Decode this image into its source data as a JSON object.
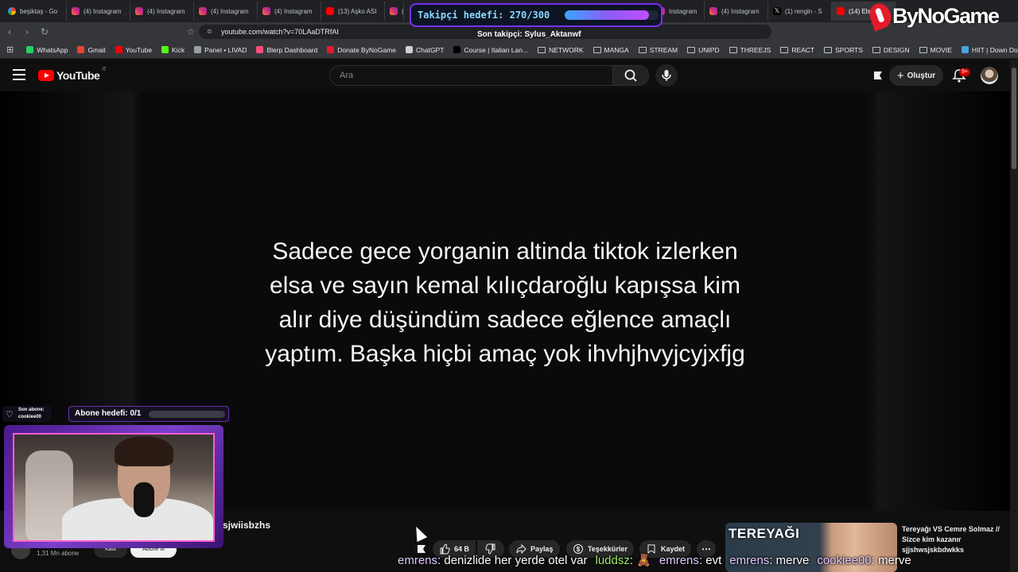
{
  "browser": {
    "tabs": [
      {
        "label": "beşiktaş - Go",
        "icon": "google-icon"
      },
      {
        "label": "(4) Instagram",
        "icon": "instagram-icon"
      },
      {
        "label": "(4) Instagram",
        "icon": "instagram-icon"
      },
      {
        "label": "(4) Instagram",
        "icon": "instagram-icon"
      },
      {
        "label": "(4) Instagram",
        "icon": "instagram-icon"
      },
      {
        "label": "(13) Aşko ASI",
        "icon": "youtube-icon"
      },
      {
        "label": "(4",
        "icon": "instagram-icon"
      },
      {
        "label": "Instagram",
        "icon": "instagram-icon"
      },
      {
        "label": "(4) Instagram",
        "icon": "instagram-icon"
      },
      {
        "label": "(1) rengin - S",
        "icon": "x-icon"
      },
      {
        "label": "(14) Els",
        "icon": "youtube-icon"
      }
    ],
    "url": "youtube.com/watch?v=70LAaDTRfAI",
    "bookmarks": [
      {
        "label": "WhatsApp",
        "type": "site",
        "color": "#25d366"
      },
      {
        "label": "Gmail",
        "type": "site",
        "color": "#ea4335"
      },
      {
        "label": "YouTube",
        "type": "site",
        "color": "#ff0000"
      },
      {
        "label": "Kick",
        "type": "site",
        "color": "#53fc18"
      },
      {
        "label": "Panel • LIVAD",
        "type": "site",
        "color": "#9aa0a6"
      },
      {
        "label": "Blerp Dashboard",
        "type": "site",
        "color": "#ff4f7b"
      },
      {
        "label": "Donate ByNoGame",
        "type": "site",
        "color": "#e31b2a"
      },
      {
        "label": "ChatGPT",
        "type": "site",
        "color": "#d0d0d0"
      },
      {
        "label": "Course | Italian Lan...",
        "type": "site",
        "color": "#000000"
      },
      {
        "label": "NETWORK",
        "type": "folder"
      },
      {
        "label": "MANGA",
        "type": "folder"
      },
      {
        "label": "STREAM",
        "type": "folder"
      },
      {
        "label": "UNIPD",
        "type": "folder"
      },
      {
        "label": "THREEJS",
        "type": "folder"
      },
      {
        "label": "REACT",
        "type": "folder"
      },
      {
        "label": "SPORTS",
        "type": "folder"
      },
      {
        "label": "DESIGN",
        "type": "folder"
      },
      {
        "label": "MOVIE",
        "type": "folder"
      },
      {
        "label": "HIIT | Down Dog",
        "type": "site",
        "color": "#4aa3df"
      }
    ]
  },
  "youtube": {
    "logo_text": "YouTube",
    "country_code": "IT",
    "search_placeholder": "Ara",
    "create_label": "Oluştur",
    "notification_count": "9+",
    "video_caption": "Sadece gece yorganin altinda tiktok izlerken\nelsa ve sayın kemal kılıçdaroğlu kapışsa kim\nalır diye düşündüm  sadece eğlence amaçlı\nyaptım. Başka hiçbi amaç yok ihvhjhvyjcyjxfjg",
    "video_title": "sjwiisbzhs",
    "subscriber_count": "1,31 Mn abone",
    "join_label": "Katıl",
    "subscribe_label": "Abone ol",
    "actions": {
      "likes": "64 B",
      "share": "Paylaş",
      "thanks": "Teşekkürler",
      "save": "Kaydet"
    },
    "suggested": {
      "thumbnail_text": "TEREYAĞI",
      "title": "Tereyağı VS Cemre Solmaz // Sizce kim kazanır",
      "channel": "sjjshwsjskbdwkks"
    }
  },
  "overlays": {
    "follow_goal_label": "Takipçi hedefi: 270/300",
    "follow_goal_progress": 0.9,
    "last_follower": "Son takipçi: Sylus_Aktanwf",
    "brand": "ByNoGame",
    "last_sub_title": "Son abone:",
    "last_sub_name": "cookiee00",
    "sub_goal_label": "Abone hedefi: 0/1",
    "sub_goal_progress": 0,
    "chat": [
      {
        "user": "emrens",
        "text": "denizlide her yerde otel var"
      },
      {
        "user": "luddsz",
        "text": "🧸"
      },
      {
        "user": "emrens",
        "text": "evt"
      },
      {
        "user": "emrens",
        "text": "merve"
      },
      {
        "user": "cookiee00",
        "text": "merve"
      }
    ]
  }
}
